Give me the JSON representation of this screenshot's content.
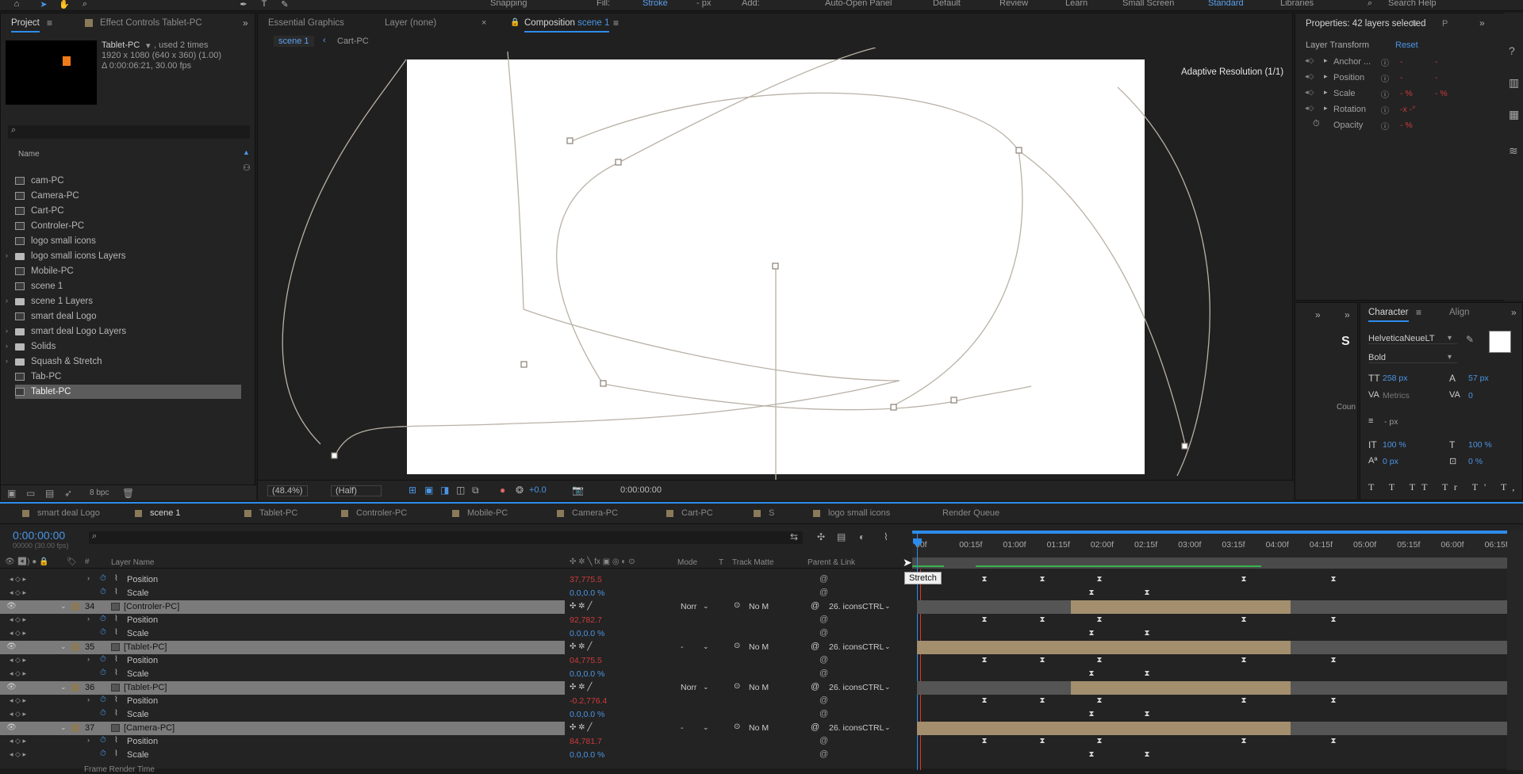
{
  "topbar": {
    "snapping": "Snapping",
    "fill": "Fill:",
    "stroke": "Stroke",
    "stroke_units": "- px",
    "add": "Add:",
    "auto_open": "Auto-Open Panel",
    "workspaces": [
      "Default",
      "Review",
      "Learn",
      "Small Screen",
      "Standard",
      "Libraries"
    ],
    "active_workspace": "Standard",
    "search_help": "Search Help"
  },
  "project": {
    "tab_project": "Project",
    "tab_effects": "Effect Controls Tablet-PC",
    "sel_name": "Tablet-PC",
    "sel_used": ", used 2 times",
    "sel_dims": "1920 x 1080  (640 x 360) (1.00)",
    "sel_duration": "Δ 0:00:06:21, 30.00 fps",
    "col_name": "Name",
    "items": [
      {
        "label": "cam-PC",
        "type": "comp"
      },
      {
        "label": "Camera-PC",
        "type": "comp"
      },
      {
        "label": "Cart-PC",
        "type": "comp"
      },
      {
        "label": "Controler-PC",
        "type": "comp"
      },
      {
        "label": "logo small icons",
        "type": "comp"
      },
      {
        "label": "logo small icons Layers",
        "type": "folder"
      },
      {
        "label": "Mobile-PC",
        "type": "comp"
      },
      {
        "label": "scene 1",
        "type": "comp"
      },
      {
        "label": "scene 1 Layers",
        "type": "folder"
      },
      {
        "label": "smart deal Logo",
        "type": "comp"
      },
      {
        "label": "smart deal Logo Layers",
        "type": "folder"
      },
      {
        "label": "Solids",
        "type": "folder"
      },
      {
        "label": "Squash & Stretch",
        "type": "folder"
      },
      {
        "label": "Tab-PC",
        "type": "comp"
      },
      {
        "label": "Tablet-PC",
        "type": "comp"
      }
    ],
    "bpc": "8 bpc"
  },
  "viewer": {
    "tab_essential": "Essential Graphics",
    "tab_layer": "Layer  (none)",
    "tab_comp_prefix": "Composition",
    "tab_comp_name": "scene 1",
    "crumb1": "scene 1",
    "crumb2": "Cart-PC",
    "adaptive": "Adaptive Resolution (1/1)",
    "zoom": "(48.4%)",
    "resolution": "(Half)",
    "exposure": "+0.0",
    "timecode": "0:00:00:00"
  },
  "properties": {
    "title": "Properties: 42 layers selected",
    "section": "Layer Transform",
    "reset": "Reset",
    "rows": [
      {
        "label": "Anchor ...",
        "v1": "-",
        "v2": "-"
      },
      {
        "label": "Position",
        "v1": "-",
        "v2": "-"
      },
      {
        "label": "Scale",
        "v1": "- %",
        "v2": "- %"
      },
      {
        "label": "Rotation",
        "v1": "-x -°",
        "v2": ""
      },
      {
        "label": "Opacity",
        "v1": "- %",
        "v2": ""
      }
    ]
  },
  "character": {
    "tab_char": "Character",
    "tab_align": "Align",
    "font": "HelveticaNeueLT",
    "style": "Bold",
    "size": "258 px",
    "leading": "57 px",
    "kerning": "Metrics",
    "tracking": "0",
    "stroke_w": "- px",
    "vscale": "100 %",
    "hscale": "100 %",
    "baseline": "0 px",
    "tsume": "0 %",
    "side_label": "Coun"
  },
  "timeline": {
    "tabs": [
      "smart deal Logo",
      "scene 1",
      "Tablet-PC",
      "Controler-PC",
      "Mobile-PC",
      "Camera-PC",
      "Cart-PC",
      "S",
      "logo small icons",
      "Render Queue"
    ],
    "active_tab": "scene 1",
    "timecode": "0:00:00:00",
    "fps": "00000 (30.00 fps)",
    "col_layer": "Layer Name",
    "col_mode": "Mode",
    "col_t": "T",
    "col_track": "Track Matte",
    "col_parent": "Parent & Link",
    "ruler": [
      "00f",
      "00:15f",
      "01:00f",
      "01:15f",
      "02:00f",
      "02:15f",
      "03:00f",
      "03:15f",
      "04:00f",
      "04:15f",
      "05:00f",
      "05:15f",
      "06:00f",
      "06:15f"
    ],
    "tooltip": "Stretch",
    "footer": "Frame Render Time",
    "rows": [
      {
        "kind": "prop",
        "label": "Position",
        "value": "37,775.5",
        "red": true
      },
      {
        "kind": "prop",
        "label": "Scale",
        "value": "0.0,0.0 %",
        "red": false
      },
      {
        "kind": "layer",
        "num": "34",
        "label": "[Controler-PC]",
        "mode": "Norr",
        "matte": "No M",
        "parent": "26. iconsCTRL"
      },
      {
        "kind": "prop",
        "label": "Position",
        "value": "92,782.7",
        "red": true
      },
      {
        "kind": "prop",
        "label": "Scale",
        "value": "0.0,0.0 %",
        "red": false
      },
      {
        "kind": "layer",
        "num": "35",
        "label": "[Tablet-PC]",
        "mode": "-",
        "matte": "No M",
        "parent": "26. iconsCTRL"
      },
      {
        "kind": "prop",
        "label": "Position",
        "value": "04,775.5",
        "red": true
      },
      {
        "kind": "prop",
        "label": "Scale",
        "value": "0.0,0.0 %",
        "red": false
      },
      {
        "kind": "layer",
        "num": "36",
        "label": "[Tablet-PC]",
        "mode": "Norr",
        "matte": "No M",
        "parent": "26. iconsCTRL"
      },
      {
        "kind": "prop",
        "label": "Position",
        "value": "-0.2,776.4",
        "red": true
      },
      {
        "kind": "prop",
        "label": "Scale",
        "value": "0.0,0.0 %",
        "red": false
      },
      {
        "kind": "layer",
        "num": "37",
        "label": "[Camera-PC]",
        "mode": "-",
        "matte": "No M",
        "parent": "26. iconsCTRL"
      },
      {
        "kind": "prop",
        "label": "Position",
        "value": "84,781.7",
        "red": true
      },
      {
        "kind": "prop",
        "label": "Scale",
        "value": "0.0,0.0 %",
        "red": false
      }
    ]
  }
}
